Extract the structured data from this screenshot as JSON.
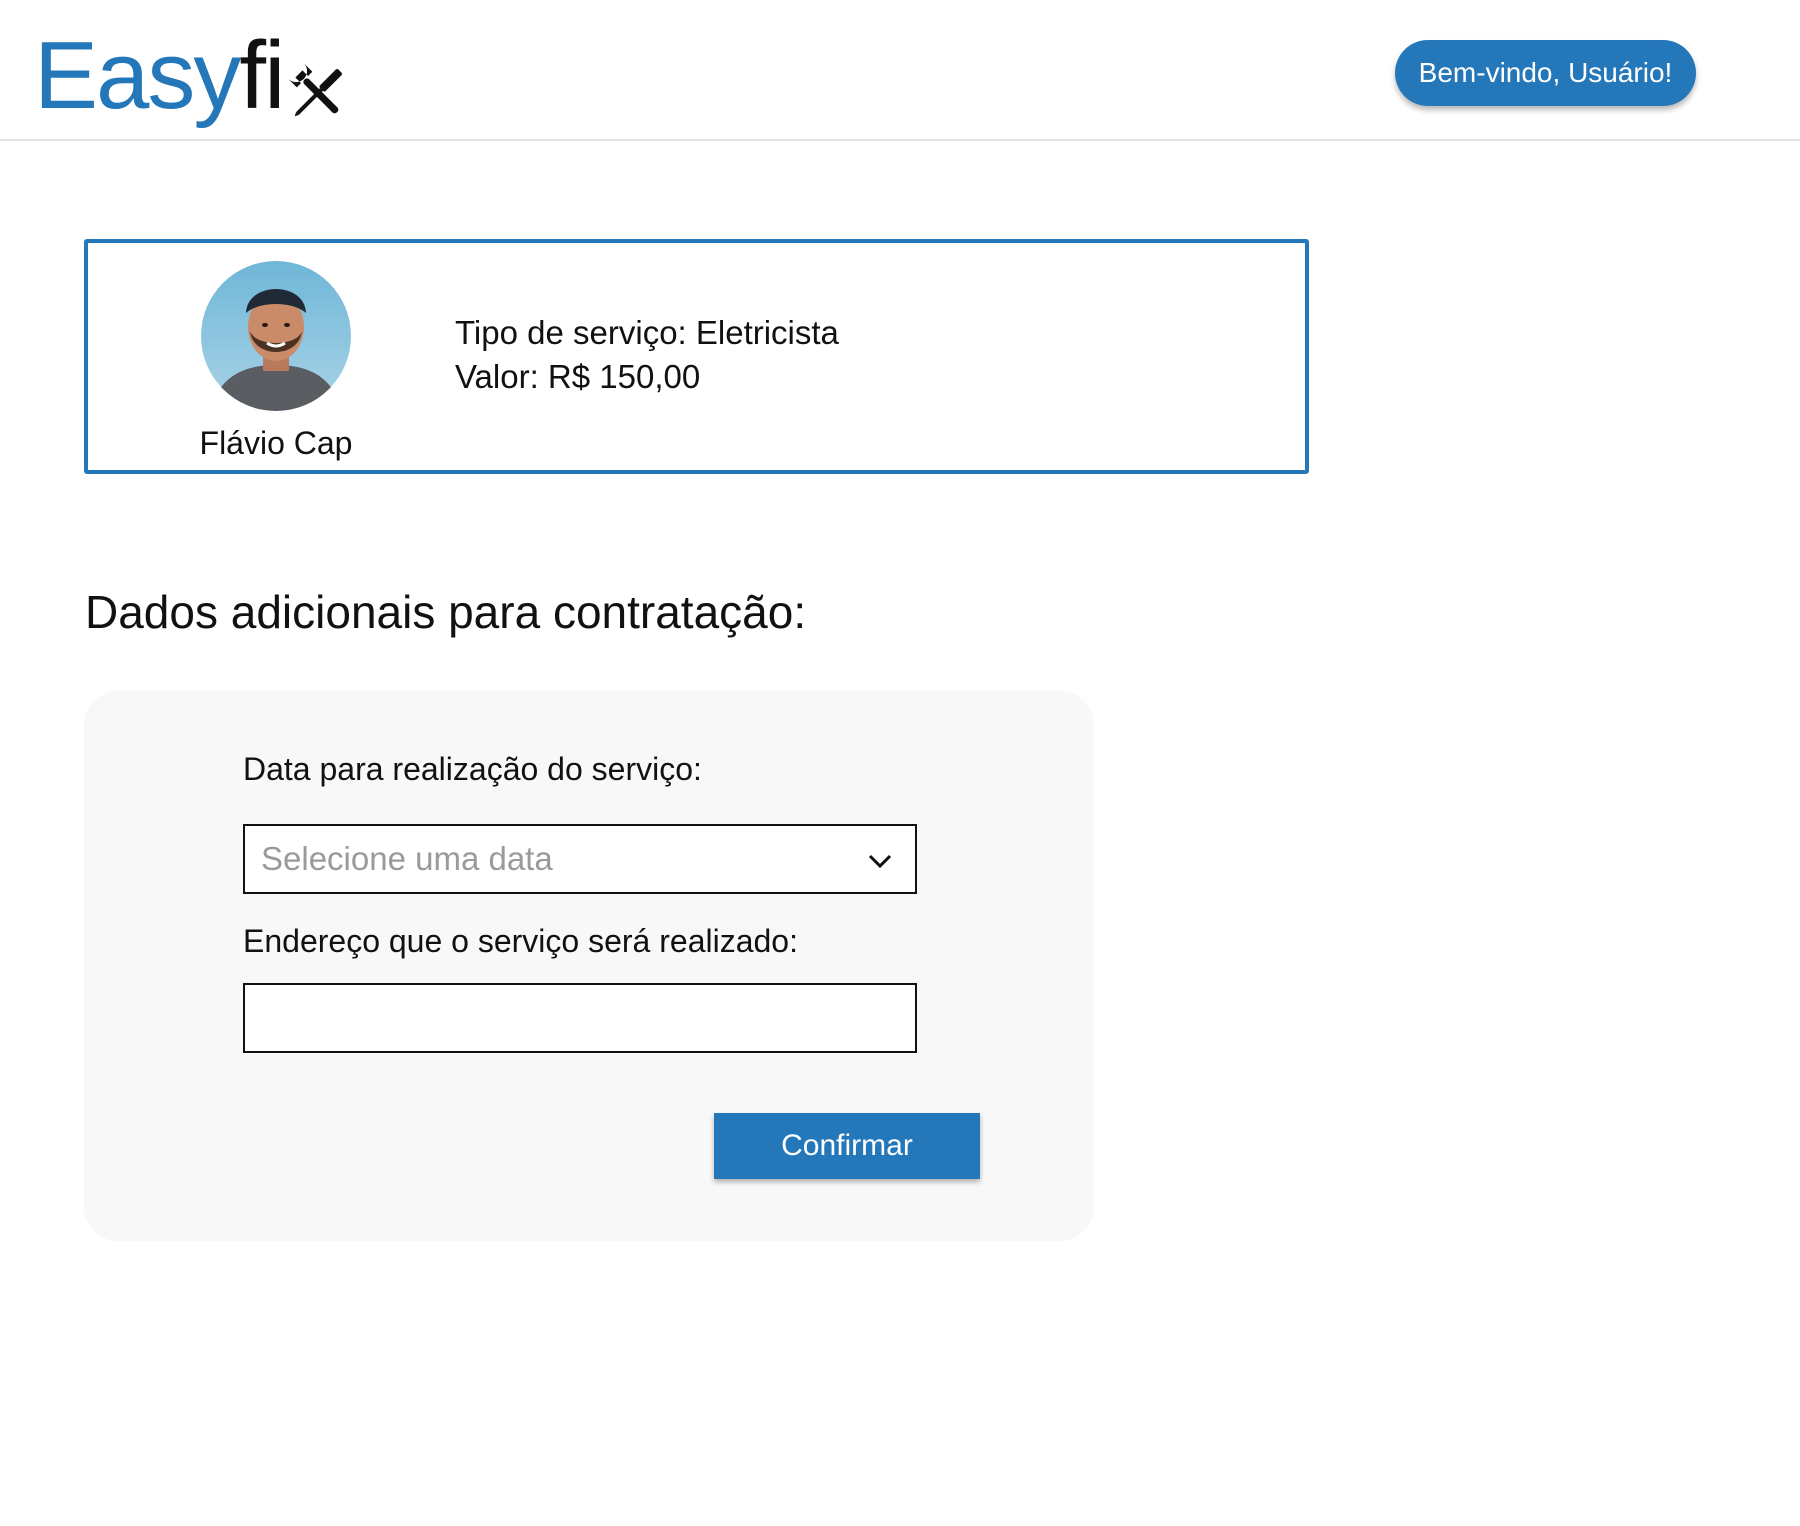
{
  "header": {
    "logo": {
      "part1": "Easy",
      "part2": "fi",
      "icon": "tools-icon"
    },
    "welcome_button": "Bem-vindo, Usuário!"
  },
  "provider": {
    "name": "Flávio Cap",
    "avatar_icon": "avatar",
    "service_type": "Tipo de serviço: Eletricista",
    "price": "Valor: R$ 150,00"
  },
  "section": {
    "title": "Dados adicionais para contratação:"
  },
  "form": {
    "date_label": "Data para realização do serviço:",
    "date_placeholder": "Selecione uma data",
    "address_label": "Endereço que o serviço será realizado:",
    "address_value": "",
    "confirm_label": "Confirmar"
  },
  "colors": {
    "brand": "#2477b9",
    "panel": "#f8f8f8"
  }
}
